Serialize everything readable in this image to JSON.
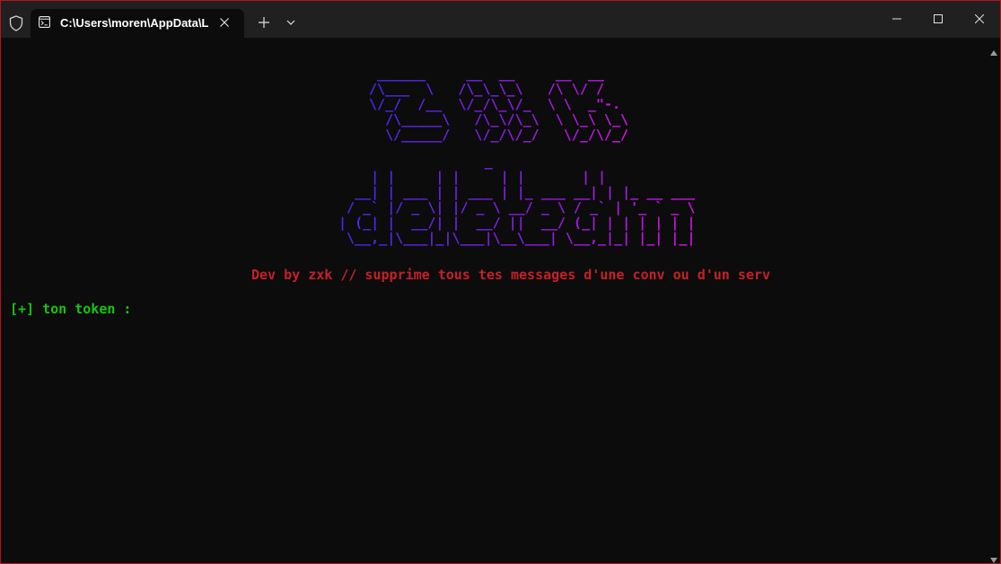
{
  "tab": {
    "title": "C:\\Users\\moren\\AppData\\Local\\Programs\\Python\\python.exe"
  },
  "terminal": {
    "ascii_top": "  ______     __  __     __  __\n /\\___  \\   /\\_\\_\\_\\   /\\ \\/ /\n \\/_/  /__  \\/_/\\_\\/_  \\ \\  _\"-.\n   /\\_____\\   /\\_\\/\\_\\  \\ \\_\\ \\_\\\n   \\/_____/   \\/_/\\/_/   \\/_/\\/_/",
    "ascii_bottom": "                   _\n     | |     | |     | |       | |\n   __| | ___ | | ___ | |_ ___ __| | |_ __ ___\n  / _` |/ _ \\| |/ _ \\ __/ _ \\ / _` | '_ ` _ \\\n | (_| |  __/| |  __/ ||  __/ (_| | | | | | |\n  \\__,_|\\___|_|\\___|\\__\\___| \\__,_|_| |_| |_|",
    "subtitle": "Dev by zxk // supprime tous tes messages d'une conv ou d'un serv",
    "prompt": "[+] ton token :"
  },
  "colors": {
    "border": "#b4141e",
    "subtitle": "#c72027",
    "prompt": "#16c60c",
    "ascii_gradient": [
      "#3b2cf0",
      "#7a1fe8",
      "#d613e6"
    ]
  },
  "icons": {
    "shield": "shield-icon",
    "tab": "terminal-tab-icon",
    "close": "close-icon",
    "new_tab": "plus-icon",
    "dropdown": "chevron-down-icon",
    "minimize": "minimize-icon",
    "maximize": "maximize-icon",
    "window_close": "window-close-icon",
    "scroll_up": "scroll-up-arrow-icon",
    "scroll_down": "scroll-down-arrow-icon"
  }
}
